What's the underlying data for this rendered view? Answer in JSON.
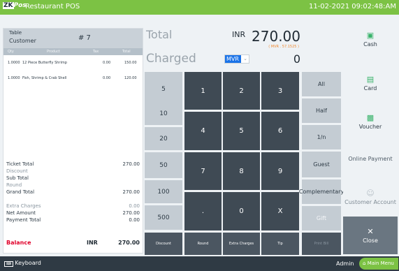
{
  "header": {
    "logo_text": "ZK",
    "logo_suffix": "Pos",
    "title": "Restaurant POS",
    "datetime": "11-02-2021 09:02:48:AM"
  },
  "ticket": {
    "table_label": "Table",
    "customer_label": "Customer",
    "table_number": "# 7",
    "columns": [
      "Qty",
      "Product",
      "Tax",
      "Total"
    ],
    "items": [
      {
        "qty": "1.0000",
        "product": "12 Piece Butterfly Shrimp",
        "tax": "0.00",
        "total": "150.00"
      },
      {
        "qty": "1.0000",
        "product": "Fish, Shrimp & Crab Shell",
        "tax": "0.00",
        "total": "120.00"
      }
    ],
    "totals": [
      {
        "label": "Ticket Total",
        "value": "270.00",
        "muted": false
      },
      {
        "label": "Discount",
        "value": "",
        "muted": true
      },
      {
        "label": "Sub Total",
        "value": "",
        "muted": false
      },
      {
        "label": "Round",
        "value": "",
        "muted": true
      },
      {
        "label": "Grand Total",
        "value": "270.00",
        "muted": false
      },
      {
        "label": "",
        "value": "",
        "muted": false
      },
      {
        "label": "Extra Charges",
        "value": "0.00",
        "muted": true
      },
      {
        "label": "Net Amount",
        "value": "270.00",
        "muted": false
      },
      {
        "label": "Payment Total",
        "value": "0.00",
        "muted": false
      }
    ],
    "balance_label": "Balance",
    "balance_currency": "INR",
    "balance_value": "270.00"
  },
  "amount": {
    "total_label": "Total",
    "currency": "INR",
    "total_value": "270.00",
    "mvr_note": "( MVR . 57.1525 )",
    "charged_label": "Charged",
    "charged_currency": "MVR",
    "charged_value": "0"
  },
  "keypad": {
    "quick": [
      "5",
      "10",
      "20",
      "50",
      "100",
      "500"
    ],
    "digits": [
      "1",
      "2",
      "3",
      "4",
      "5",
      "6",
      "7",
      "8",
      "9",
      ".",
      "0",
      "X"
    ],
    "functions": [
      "All",
      "Half",
      "1/n",
      "Guest",
      "Complementary",
      "Gift"
    ],
    "bottom": [
      "Discount",
      "Round",
      "Extra Charges",
      "Tip",
      "Print Bill"
    ]
  },
  "tenders": {
    "cash": "Cash",
    "card": "Card",
    "voucher": "Voucher",
    "online": "Online Payment",
    "customer_account": "Customer Account",
    "close": "Close"
  },
  "footer": {
    "keyboard": "Keyboard",
    "admin": "Admin",
    "main_menu": "Main Menu"
  },
  "colors": {
    "brand_green": "#7cc244",
    "balance_red": "#e0002a",
    "dark_key": "#3f4a54"
  }
}
